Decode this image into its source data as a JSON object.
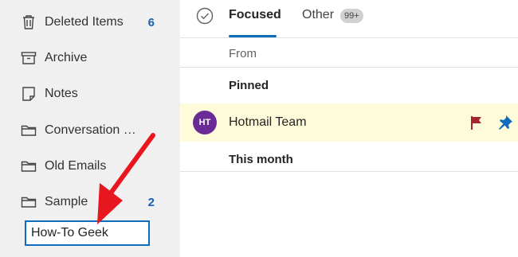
{
  "sidebar": {
    "folders": [
      {
        "label": "Deleted Items",
        "count": "6",
        "icon": "trash-icon"
      },
      {
        "label": "Archive",
        "count": "",
        "icon": "archive-icon"
      },
      {
        "label": "Notes",
        "count": "",
        "icon": "note-icon"
      },
      {
        "label": "Conversation History",
        "count": "",
        "icon": "folder-icon"
      },
      {
        "label": "Old Emails",
        "count": "",
        "icon": "folder-icon"
      },
      {
        "label": "Sample",
        "count": "2",
        "icon": "folder-icon"
      }
    ],
    "new_folder_value": "How-To Geek",
    "annotation_arrow_color": "#e8161e"
  },
  "mail_list": {
    "tabs": [
      {
        "label": "Focused",
        "selected": true
      },
      {
        "label": "Other",
        "badge": "99+"
      }
    ],
    "from_label": "From",
    "sections": {
      "pinned": "Pinned",
      "this_month": "This month"
    },
    "pinned_message": {
      "avatar_initials": "HT",
      "avatar_color": "#6b2b97",
      "sender": "Hotmail Team",
      "flag_color": "#a4262c",
      "pin_color": "#0f6cbd",
      "background": "#fdfbd9"
    }
  },
  "colors": {
    "accent": "#0f6cbd",
    "count": "#1b5fb0",
    "sidebar_bg": "#f0f0f0"
  }
}
